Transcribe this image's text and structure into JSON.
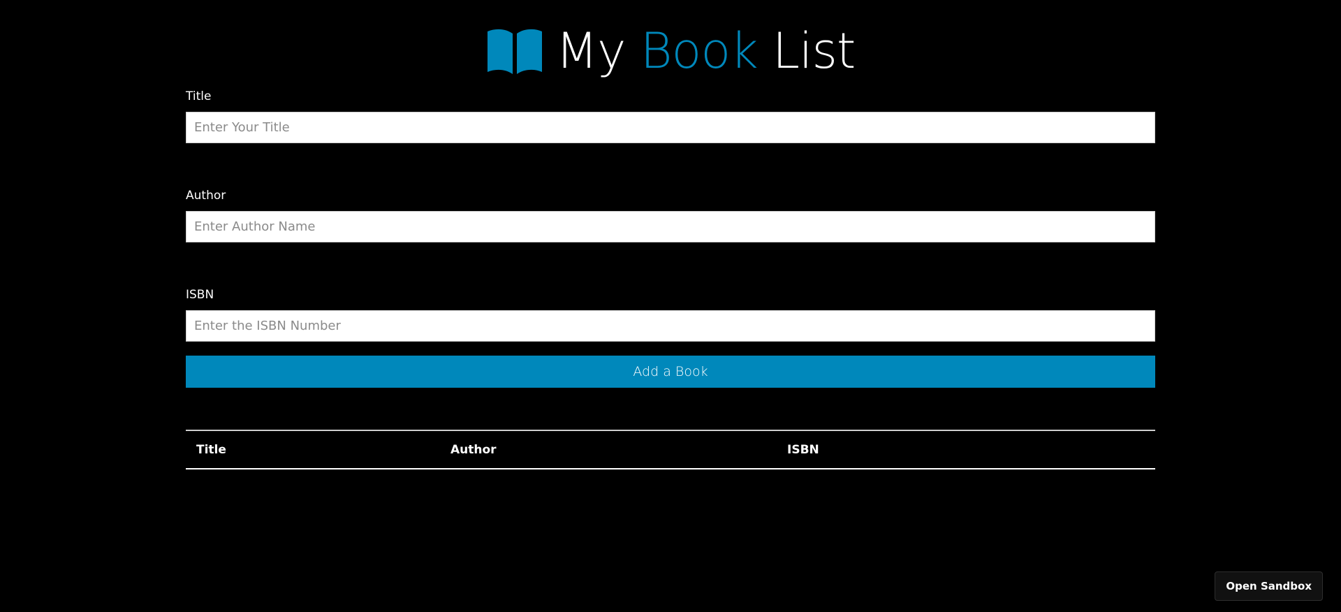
{
  "header": {
    "title_part1": "My",
    "title_part2": "Book",
    "title_part3": "List",
    "logo_icon": "open-book-icon",
    "accent_color": "#0088bb"
  },
  "form": {
    "title_label": "Title",
    "title_placeholder": "Enter Your Title",
    "author_label": "Author",
    "author_placeholder": "Enter Author Name",
    "isbn_label": "ISBN",
    "isbn_placeholder": "Enter the ISBN Number",
    "submit_label": "Add a Book"
  },
  "table": {
    "columns": [
      "Title",
      "Author",
      "ISBN"
    ],
    "rows": []
  },
  "sandbox": {
    "label": "Open Sandbox"
  }
}
